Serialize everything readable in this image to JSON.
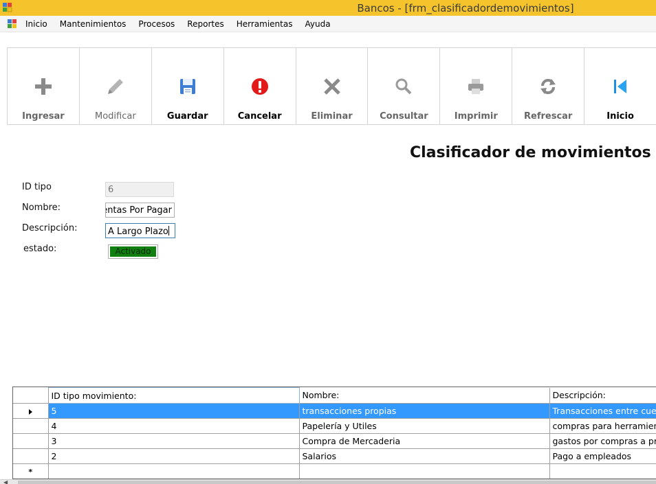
{
  "window": {
    "title": "Bancos - [frm_clasificadordemovimientos]",
    "title_bar_color": "#f5c32b"
  },
  "menu": {
    "items": [
      "Inicio",
      "Mantenimientos",
      "Procesos",
      "Reportes",
      "Herramientas",
      "Ayuda"
    ]
  },
  "toolbar": {
    "buttons": [
      {
        "label": "Ingresar",
        "icon": "plus-icon",
        "enabled": false
      },
      {
        "label": "Modificar",
        "icon": "pencil-icon",
        "enabled": false
      },
      {
        "label": "Guardar",
        "icon": "floppy-disk-icon",
        "enabled": true
      },
      {
        "label": "Cancelar",
        "icon": "stop-alert-icon",
        "enabled": true
      },
      {
        "label": "Eliminar",
        "icon": "x-delete-icon",
        "enabled": false
      },
      {
        "label": "Consultar",
        "icon": "magnifier-icon",
        "enabled": false
      },
      {
        "label": "Imprimir",
        "icon": "printer-icon",
        "enabled": false
      },
      {
        "label": "Refrescar",
        "icon": "refresh-icon",
        "enabled": false
      },
      {
        "label": "Inicio",
        "icon": "first-record-icon",
        "enabled": true
      }
    ]
  },
  "form": {
    "title": "Clasificador de movimientos",
    "id_label": "ID tipo",
    "id_value": "6",
    "nombre_label": "Nombre:",
    "nombre_value": "Cuentas Por Pagar",
    "descripcion_label": "Descripción:",
    "descripcion_value": "A Largo Plazo",
    "estado_label": "estado:",
    "estado_value": "Activado",
    "estado_color": "#108010"
  },
  "grid": {
    "columns": [
      "ID tipo movimiento:",
      "Nombre:",
      "Descripción:"
    ],
    "rows": [
      {
        "id": "5",
        "nombre": "transacciones propias",
        "descripcion": "Transacciones entre cuen",
        "selected": true
      },
      {
        "id": "4",
        "nombre": "Papelería y Utiles",
        "descripcion": "compras para herramienta",
        "selected": false
      },
      {
        "id": "3",
        "nombre": "Compra de Mercaderia",
        "descripcion": "gastos por compras a pro",
        "selected": false
      },
      {
        "id": "2",
        "nombre": "Salarios",
        "descripcion": "Pago a empleados",
        "selected": false
      }
    ],
    "new_row_marker": "*",
    "selection_color": "#3399ff"
  }
}
